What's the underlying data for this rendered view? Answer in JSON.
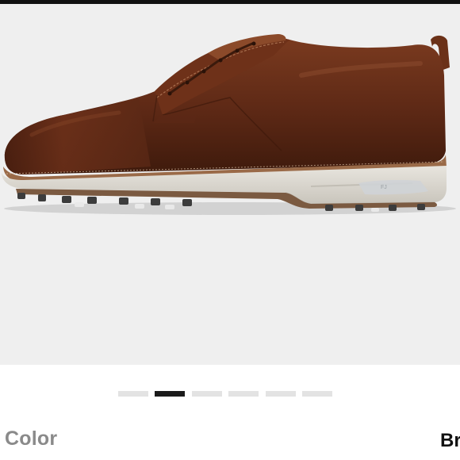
{
  "product": {
    "image_icon": "golf-shoe",
    "image_alt": "",
    "colors": {
      "upper": "#5a2a18",
      "sole": "#d9d6cf",
      "background": "#efefef"
    }
  },
  "carousel": {
    "count": 6,
    "active_index": 1
  },
  "details": {
    "color_label": "Color",
    "color_value_partial": "Br"
  }
}
